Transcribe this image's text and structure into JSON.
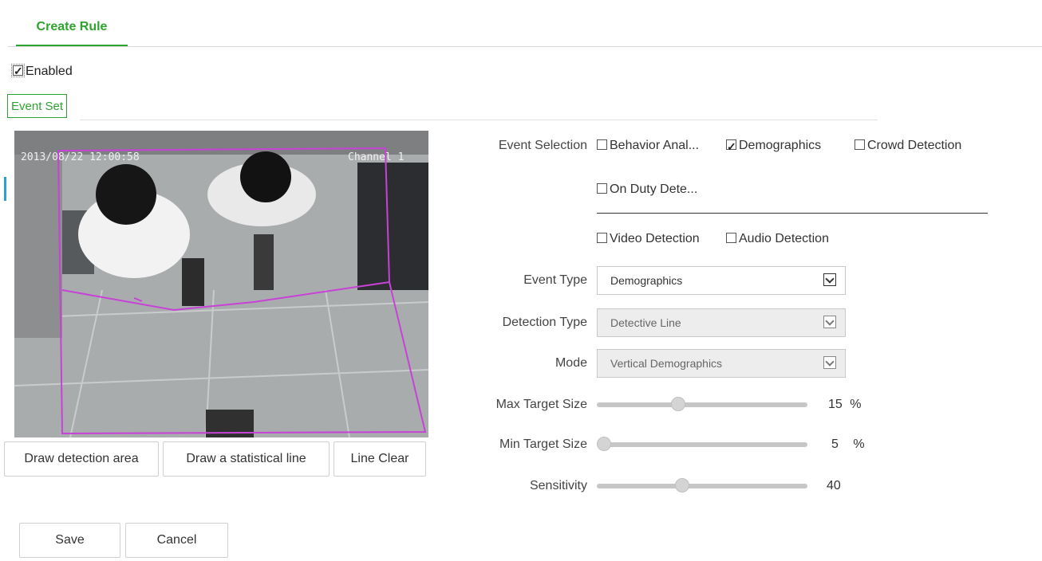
{
  "tab": {
    "label": "Create Rule"
  },
  "enabled": {
    "label": "Enabled",
    "checked": true
  },
  "section_tab": {
    "label": "Event Set"
  },
  "video": {
    "timestamp": "2013/08/22 12:00:58",
    "channel": "Channel 1"
  },
  "draw_buttons": {
    "draw_area": "Draw detection area",
    "draw_line": "Draw a statistical line",
    "clear": "Line Clear"
  },
  "event_selection": {
    "label": "Event Selection",
    "options": [
      {
        "label": "Behavior Anal...",
        "checked": false
      },
      {
        "label": "Demographics",
        "checked": true
      },
      {
        "label": "Crowd Detection",
        "checked": false
      },
      {
        "label": "On Duty Dete...",
        "checked": false
      },
      {
        "label": "Video Detection",
        "checked": false
      },
      {
        "label": "Audio Detection",
        "checked": false
      }
    ]
  },
  "event_type": {
    "label": "Event Type",
    "value": "Demographics"
  },
  "detection_type": {
    "label": "Detection Type",
    "value": "Detective Line"
  },
  "mode": {
    "label": "Mode",
    "value": "Vertical Demographics"
  },
  "max_target": {
    "label": "Max Target Size",
    "value": "15",
    "unit": "%",
    "fraction": 0.38
  },
  "min_target": {
    "label": "Min Target Size",
    "value": "5",
    "unit": "%",
    "fraction": 0.0
  },
  "sensitivity": {
    "label": "Sensitivity",
    "value": "40",
    "fraction": 0.4
  },
  "actions": {
    "save": "Save",
    "cancel": "Cancel"
  },
  "colors": {
    "accent": "#2fa32f",
    "region": "#c742d6",
    "indicator": "#25a3d9"
  }
}
